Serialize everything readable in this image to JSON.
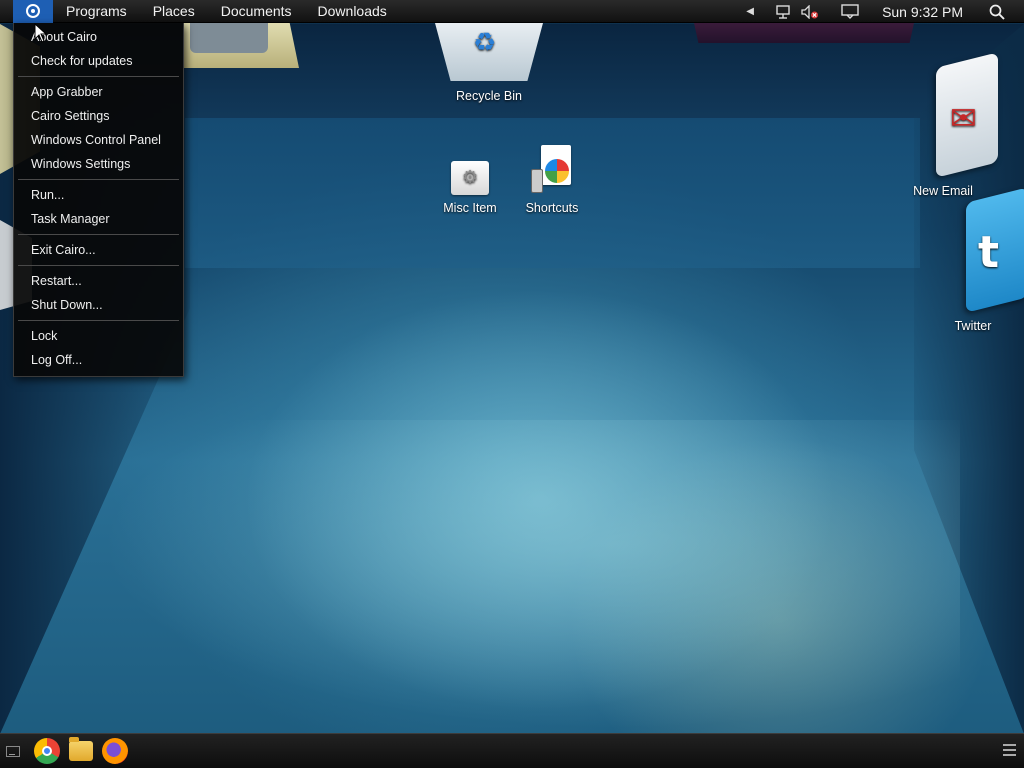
{
  "menubar": {
    "items": [
      "Programs",
      "Places",
      "Documents",
      "Downloads"
    ],
    "clock": "Sun 9:32 PM"
  },
  "start_menu": {
    "groups": [
      [
        "About Cairo",
        "Check for updates"
      ],
      [
        "App Grabber",
        "Cairo Settings",
        "Windows Control Panel",
        "Windows Settings"
      ],
      [
        "Run...",
        "Task Manager"
      ],
      [
        "Exit Cairo..."
      ],
      [
        "Restart...",
        "Shut Down..."
      ],
      [
        "Lock",
        "Log Off..."
      ]
    ]
  },
  "desktop_icons": {
    "recycle_bin": "Recycle Bin",
    "misc_item": "Misc Item",
    "shortcuts": "Shortcuts",
    "new_email": "New Email",
    "twitter": "Twitter"
  },
  "taskbar": {
    "apps": [
      "chrome-icon",
      "folder-icon",
      "firefox-icon"
    ]
  }
}
